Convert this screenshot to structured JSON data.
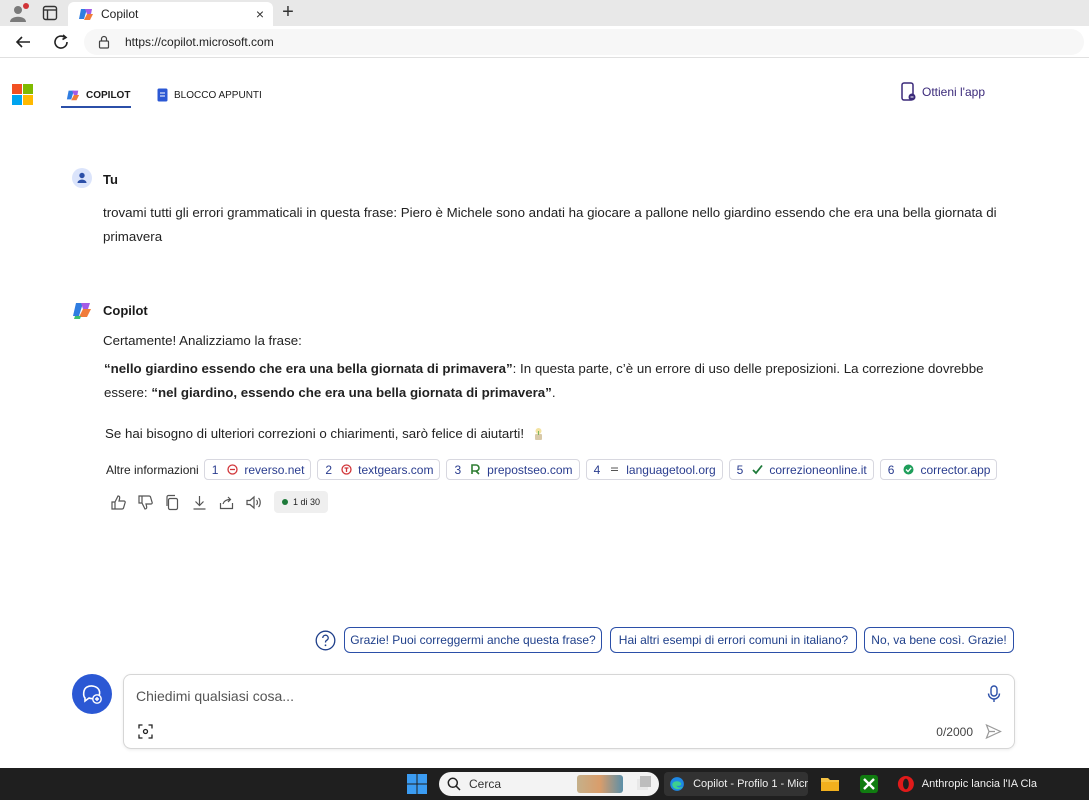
{
  "browser": {
    "tab_title": "Copilot",
    "tab_close": "×",
    "new_tab": "+",
    "url": "https://copilot.microsoft.com"
  },
  "header": {
    "nav": [
      {
        "label": "COPILOT",
        "icon": "copilot-logo-icon",
        "active": true
      },
      {
        "label": "BLOCCO APPUNTI",
        "icon": "notebook-icon",
        "active": false
      }
    ],
    "get_app_label": "Ottieni l'app"
  },
  "conversation": {
    "user": {
      "name": "Tu",
      "message": "trovami tutti gli errori grammaticali in questa frase: Piero è Michele sono andati ha giocare a pallone nello giardino essendo che era una bella giornata di primavera"
    },
    "copilot": {
      "name": "Copilot",
      "intro": "Certamente! Analizziamo la frase:",
      "point_quote": "“nello giardino essendo che era una bella giornata di primavera”",
      "point_text": ": In questa parte, c’è un errore di uso delle preposizioni. La correzione dovrebbe essere: ",
      "point_fix": "“nel giardino, essendo che era una bella giornata di primavera”",
      "point_end": ".",
      "closing": "Se hai bisogno di ulteriori correzioni o chiarimenti, sarò felice di aiutarti!",
      "sources_label": "Altre informazioni",
      "sources": [
        {
          "num": "1",
          "label": "reverso.net",
          "icon": "reverso-icon",
          "color": "#d13438"
        },
        {
          "num": "2",
          "label": "textgears.com",
          "icon": "textgears-icon",
          "color": "#d13438"
        },
        {
          "num": "3",
          "label": "prepostseo.com",
          "icon": "prepostseo-icon",
          "color": "#2e7d32"
        },
        {
          "num": "4",
          "label": "languagetool.org",
          "icon": "languagetool-icon",
          "color": "#555555"
        },
        {
          "num": "5",
          "label": "correzioneonline.it",
          "icon": "checkmark-icon",
          "color": "#1e7a3a"
        },
        {
          "num": "6",
          "label": "corrector.app",
          "icon": "verified-check-icon",
          "color": "#1e9e5a"
        }
      ],
      "page_indicator": "1 di 30"
    }
  },
  "suggestions": [
    "Grazie! Puoi correggermi anche questa frase?",
    "Hai altri esempi di errori comuni in italiano?",
    "No, va bene così. Grazie!"
  ],
  "composer": {
    "placeholder": "Chiedimi qualsiasi cosa...",
    "char_count": "0/2000"
  },
  "taskbar": {
    "search_label": "Cerca",
    "edge_label": "Copilot - Profilo 1 - Micr",
    "opera_label": "Anthropic lancia l'IA Cla"
  },
  "colors": {
    "accent": "#2b4fa8",
    "new_topic": "#2b58d4",
    "taskbar": "#1f1f1f"
  }
}
